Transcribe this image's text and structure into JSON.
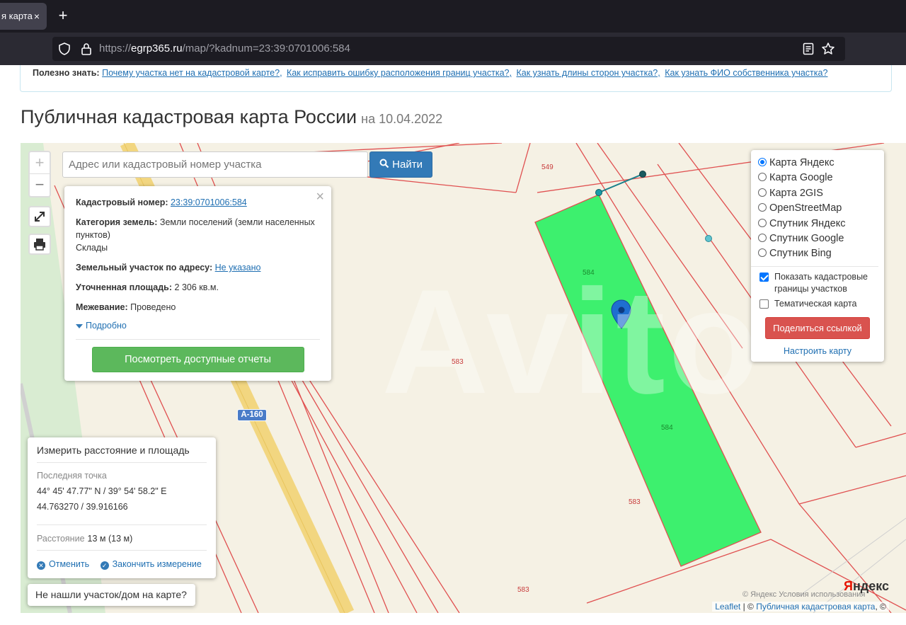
{
  "browser": {
    "tab_title": "я карта",
    "tab_close": "×",
    "new_tab": "+",
    "url_prefix": "https://",
    "url_domain": "egrp365.ru",
    "url_rest": "/map/?kadnum=23:39:0701006:584"
  },
  "info": {
    "label": "Полезно знать:",
    "links": [
      "Почему участка нет на кадастровой карте?,",
      "Как исправить ошибку расположения границ участка?,",
      "Как узнать длины сторон участка?,",
      "Как узнать ФИО собственника участка?"
    ]
  },
  "header": {
    "title": "Публичная кадастровая карта России",
    "date": "на 10.04.2022"
  },
  "map": {
    "zoom_in": "+",
    "zoom_out": "−",
    "search_placeholder": "Адрес или кадастровый номер участка",
    "find_button": "Найти",
    "road_label": "A-160",
    "plot_labels": {
      "p549": "549",
      "p584a": "584",
      "p584b": "584",
      "p583a": "583",
      "p583b": "583",
      "p583c": "583"
    },
    "watermark": "Avito",
    "yandex_logo_y": "Я",
    "yandex_logo_rest": "ндекс",
    "yandex_terms": "© Яндекс  Условия использования",
    "attribution_leaflet": "Leaflet",
    "attribution_sep": " | © ",
    "attribution_pkk": "Публичная кадастровая карта",
    "attribution_tail": ", ©",
    "colors": {
      "parcel_fill": "#3df06e",
      "boundary": "#e05050",
      "road": "#f2d680",
      "measure_line": "#1a7f8a"
    }
  },
  "popup": {
    "close": "×",
    "cadnum_label": "Кадастровый номер:",
    "cadnum_value": "23:39:0701006:584",
    "category_label": "Категория земель:",
    "category_value": "Земли поселений (земли населенных пунктов)",
    "usage": "Склады",
    "address_label": "Земельный участок по адресу:",
    "address_value": "Не указано",
    "area_label": "Уточненная площадь:",
    "area_value": "2 306 кв.м.",
    "survey_label": "Межевание:",
    "survey_value": "Проведено",
    "more": "Подробно",
    "reports_button": "Посмотреть доступные отчеты"
  },
  "layers": {
    "options": [
      {
        "label": "Карта Яндекс",
        "selected": true
      },
      {
        "label": "Карта Google",
        "selected": false
      },
      {
        "label": "Карта 2GIS",
        "selected": false
      },
      {
        "label": "OpenStreetMap",
        "selected": false
      },
      {
        "label": "Спутник Яндекс",
        "selected": false
      },
      {
        "label": "Спутник Google",
        "selected": false
      },
      {
        "label": "Спутник Bing",
        "selected": false
      }
    ],
    "show_boundaries": "Показать кадастровые границы участков",
    "show_boundaries_checked": true,
    "thematic": "Тематическая карта",
    "thematic_checked": false,
    "share_button": "Поделиться ссылкой",
    "setup_link": "Настроить карту"
  },
  "measure": {
    "title": "Измерить расстояние и площадь",
    "last_point_label": "Последняя точка",
    "coords_dms": "44° 45' 47.77\" N / 39° 54' 58.2\" E",
    "coords_dec": "44.763270 / 39.916166",
    "distance_label": "Расстояние",
    "distance_value": "13 м (13 м)",
    "cancel": "Отменить",
    "finish": "Закончить измерение"
  },
  "not_found_button": "Не нашли участок/дом на карте?"
}
